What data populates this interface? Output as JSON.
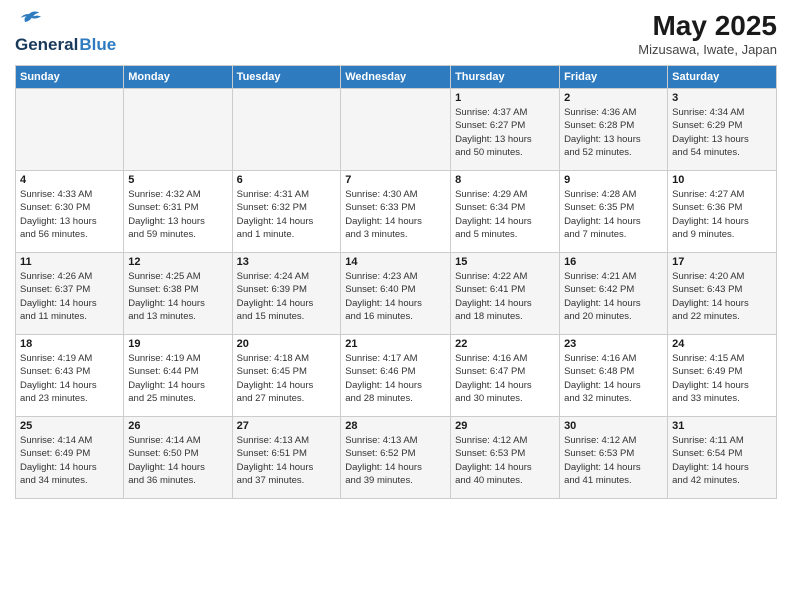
{
  "header": {
    "logo_line1": "General",
    "logo_line2": "Blue",
    "month_year": "May 2025",
    "location": "Mizusawa, Iwate, Japan"
  },
  "days_of_week": [
    "Sunday",
    "Monday",
    "Tuesday",
    "Wednesday",
    "Thursday",
    "Friday",
    "Saturday"
  ],
  "weeks": [
    [
      {
        "day": "",
        "info": ""
      },
      {
        "day": "",
        "info": ""
      },
      {
        "day": "",
        "info": ""
      },
      {
        "day": "",
        "info": ""
      },
      {
        "day": "1",
        "info": "Sunrise: 4:37 AM\nSunset: 6:27 PM\nDaylight: 13 hours\nand 50 minutes."
      },
      {
        "day": "2",
        "info": "Sunrise: 4:36 AM\nSunset: 6:28 PM\nDaylight: 13 hours\nand 52 minutes."
      },
      {
        "day": "3",
        "info": "Sunrise: 4:34 AM\nSunset: 6:29 PM\nDaylight: 13 hours\nand 54 minutes."
      }
    ],
    [
      {
        "day": "4",
        "info": "Sunrise: 4:33 AM\nSunset: 6:30 PM\nDaylight: 13 hours\nand 56 minutes."
      },
      {
        "day": "5",
        "info": "Sunrise: 4:32 AM\nSunset: 6:31 PM\nDaylight: 13 hours\nand 59 minutes."
      },
      {
        "day": "6",
        "info": "Sunrise: 4:31 AM\nSunset: 6:32 PM\nDaylight: 14 hours\nand 1 minute."
      },
      {
        "day": "7",
        "info": "Sunrise: 4:30 AM\nSunset: 6:33 PM\nDaylight: 14 hours\nand 3 minutes."
      },
      {
        "day": "8",
        "info": "Sunrise: 4:29 AM\nSunset: 6:34 PM\nDaylight: 14 hours\nand 5 minutes."
      },
      {
        "day": "9",
        "info": "Sunrise: 4:28 AM\nSunset: 6:35 PM\nDaylight: 14 hours\nand 7 minutes."
      },
      {
        "day": "10",
        "info": "Sunrise: 4:27 AM\nSunset: 6:36 PM\nDaylight: 14 hours\nand 9 minutes."
      }
    ],
    [
      {
        "day": "11",
        "info": "Sunrise: 4:26 AM\nSunset: 6:37 PM\nDaylight: 14 hours\nand 11 minutes."
      },
      {
        "day": "12",
        "info": "Sunrise: 4:25 AM\nSunset: 6:38 PM\nDaylight: 14 hours\nand 13 minutes."
      },
      {
        "day": "13",
        "info": "Sunrise: 4:24 AM\nSunset: 6:39 PM\nDaylight: 14 hours\nand 15 minutes."
      },
      {
        "day": "14",
        "info": "Sunrise: 4:23 AM\nSunset: 6:40 PM\nDaylight: 14 hours\nand 16 minutes."
      },
      {
        "day": "15",
        "info": "Sunrise: 4:22 AM\nSunset: 6:41 PM\nDaylight: 14 hours\nand 18 minutes."
      },
      {
        "day": "16",
        "info": "Sunrise: 4:21 AM\nSunset: 6:42 PM\nDaylight: 14 hours\nand 20 minutes."
      },
      {
        "day": "17",
        "info": "Sunrise: 4:20 AM\nSunset: 6:43 PM\nDaylight: 14 hours\nand 22 minutes."
      }
    ],
    [
      {
        "day": "18",
        "info": "Sunrise: 4:19 AM\nSunset: 6:43 PM\nDaylight: 14 hours\nand 23 minutes."
      },
      {
        "day": "19",
        "info": "Sunrise: 4:19 AM\nSunset: 6:44 PM\nDaylight: 14 hours\nand 25 minutes."
      },
      {
        "day": "20",
        "info": "Sunrise: 4:18 AM\nSunset: 6:45 PM\nDaylight: 14 hours\nand 27 minutes."
      },
      {
        "day": "21",
        "info": "Sunrise: 4:17 AM\nSunset: 6:46 PM\nDaylight: 14 hours\nand 28 minutes."
      },
      {
        "day": "22",
        "info": "Sunrise: 4:16 AM\nSunset: 6:47 PM\nDaylight: 14 hours\nand 30 minutes."
      },
      {
        "day": "23",
        "info": "Sunrise: 4:16 AM\nSunset: 6:48 PM\nDaylight: 14 hours\nand 32 minutes."
      },
      {
        "day": "24",
        "info": "Sunrise: 4:15 AM\nSunset: 6:49 PM\nDaylight: 14 hours\nand 33 minutes."
      }
    ],
    [
      {
        "day": "25",
        "info": "Sunrise: 4:14 AM\nSunset: 6:49 PM\nDaylight: 14 hours\nand 34 minutes."
      },
      {
        "day": "26",
        "info": "Sunrise: 4:14 AM\nSunset: 6:50 PM\nDaylight: 14 hours\nand 36 minutes."
      },
      {
        "day": "27",
        "info": "Sunrise: 4:13 AM\nSunset: 6:51 PM\nDaylight: 14 hours\nand 37 minutes."
      },
      {
        "day": "28",
        "info": "Sunrise: 4:13 AM\nSunset: 6:52 PM\nDaylight: 14 hours\nand 39 minutes."
      },
      {
        "day": "29",
        "info": "Sunrise: 4:12 AM\nSunset: 6:53 PM\nDaylight: 14 hours\nand 40 minutes."
      },
      {
        "day": "30",
        "info": "Sunrise: 4:12 AM\nSunset: 6:53 PM\nDaylight: 14 hours\nand 41 minutes."
      },
      {
        "day": "31",
        "info": "Sunrise: 4:11 AM\nSunset: 6:54 PM\nDaylight: 14 hours\nand 42 minutes."
      }
    ]
  ]
}
